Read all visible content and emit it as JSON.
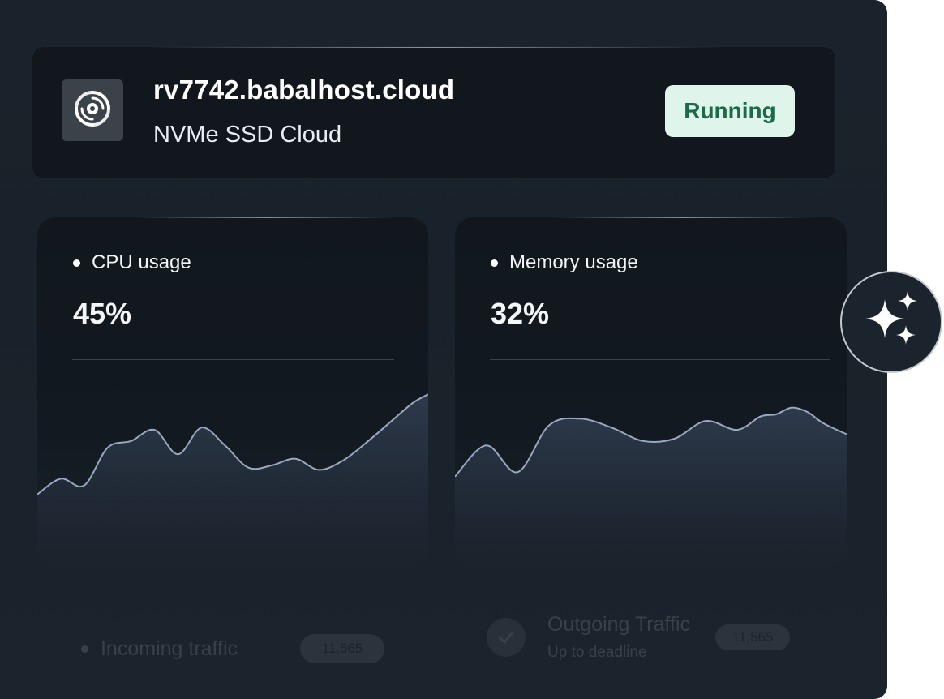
{
  "server": {
    "hostname": "rv7742.babalhost.cloud",
    "plan": "NVMe SSD Cloud",
    "status": "Running",
    "logo_icon": "swirl-logo-icon"
  },
  "metrics": {
    "cpu": {
      "label": "CPU usage",
      "value": "45%"
    },
    "memory": {
      "label": "Memory usage",
      "value": "32%"
    }
  },
  "traffic": {
    "incoming": {
      "label": "Incoming traffic",
      "count": "11,565"
    },
    "outgoing": {
      "label": "Outgoing Traffic",
      "sublabel": "Up to deadline",
      "count": "11,565"
    }
  },
  "actions": {
    "ai_icon": "sparkles-icon"
  },
  "colors": {
    "panel_bg": "#1a222b",
    "card_bg": "#11171d",
    "status_bg": "#dff5ec",
    "status_text": "#1b6a48",
    "chart_line": "#9aa8c0",
    "chart_fill": "#2e3a4c"
  },
  "chart_data": [
    {
      "type": "area",
      "title": "CPU usage",
      "x": [
        0,
        0.06,
        0.12,
        0.18,
        0.24,
        0.3,
        0.36,
        0.42,
        0.48,
        0.54,
        0.6,
        0.66,
        0.72,
        0.78,
        0.84,
        0.9,
        0.96,
        1.0
      ],
      "values": [
        14,
        21,
        18,
        35,
        38,
        43,
        32,
        44,
        36,
        26,
        27,
        30,
        25,
        29,
        37,
        46,
        55,
        59
      ],
      "ylim": [
        0,
        70
      ]
    },
    {
      "type": "area",
      "title": "Memory usage",
      "x": [
        0,
        0.08,
        0.16,
        0.24,
        0.32,
        0.4,
        0.48,
        0.56,
        0.64,
        0.72,
        0.78,
        0.82,
        0.86,
        0.9,
        0.94,
        1.0
      ],
      "values": [
        22,
        36,
        24,
        45,
        48,
        44,
        38,
        39,
        47,
        43,
        49,
        50,
        53,
        51,
        46,
        41
      ],
      "ylim": [
        0,
        70
      ]
    }
  ]
}
